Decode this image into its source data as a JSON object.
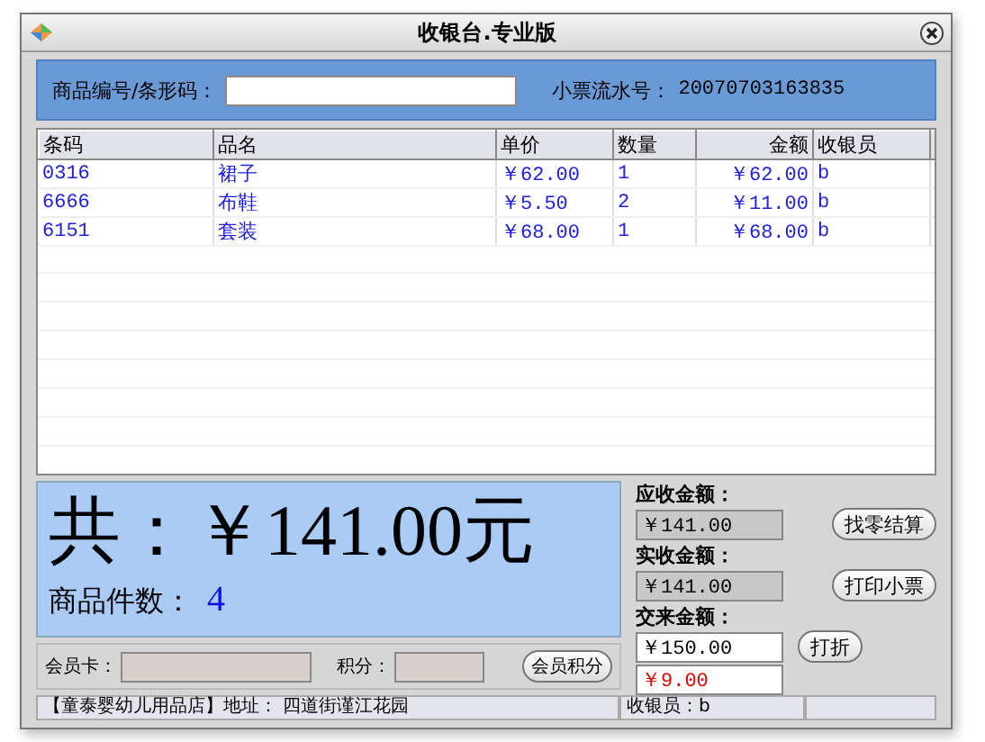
{
  "window": {
    "title": "收银台.专业版"
  },
  "search": {
    "label": "商品编号/条形码：",
    "ticket_label": "小票流水号：",
    "ticket_number": "20070703163835"
  },
  "table": {
    "columns": [
      "条码",
      "品名",
      "单价",
      "数量",
      "金额",
      "收银员"
    ],
    "rows": [
      [
        "0316",
        "裙子",
        "￥62.00",
        "1",
        "￥62.00",
        "b"
      ],
      [
        "6666",
        "布鞋",
        "￥5.50",
        "2",
        "￥11.00",
        "b"
      ],
      [
        "6151",
        "套装",
        "￥68.00",
        "1",
        "￥68.00",
        "b"
      ]
    ]
  },
  "total": {
    "text": "共：￥141.00元",
    "count_label": "商品件数：",
    "count": "4"
  },
  "payment": [
    {
      "kind": "readonly",
      "label": "应收金额：",
      "value": "￥141.00",
      "button": "找零结算"
    },
    {
      "kind": "readonly",
      "label": "实收金额：",
      "value": "￥141.00",
      "button": "打印小票"
    },
    {
      "kind": "input",
      "label": "交来金额：",
      "value": "￥150.00",
      "button": "打折"
    },
    {
      "kind": "change",
      "value": "￥9.00"
    }
  ],
  "member": {
    "card_label": "会员卡：",
    "points_label": "积分：",
    "button": "会员积分"
  },
  "status_bar": [
    "【童泰婴幼儿用品店】地址： 四道街谨江花园",
    "收银员：b"
  ]
}
